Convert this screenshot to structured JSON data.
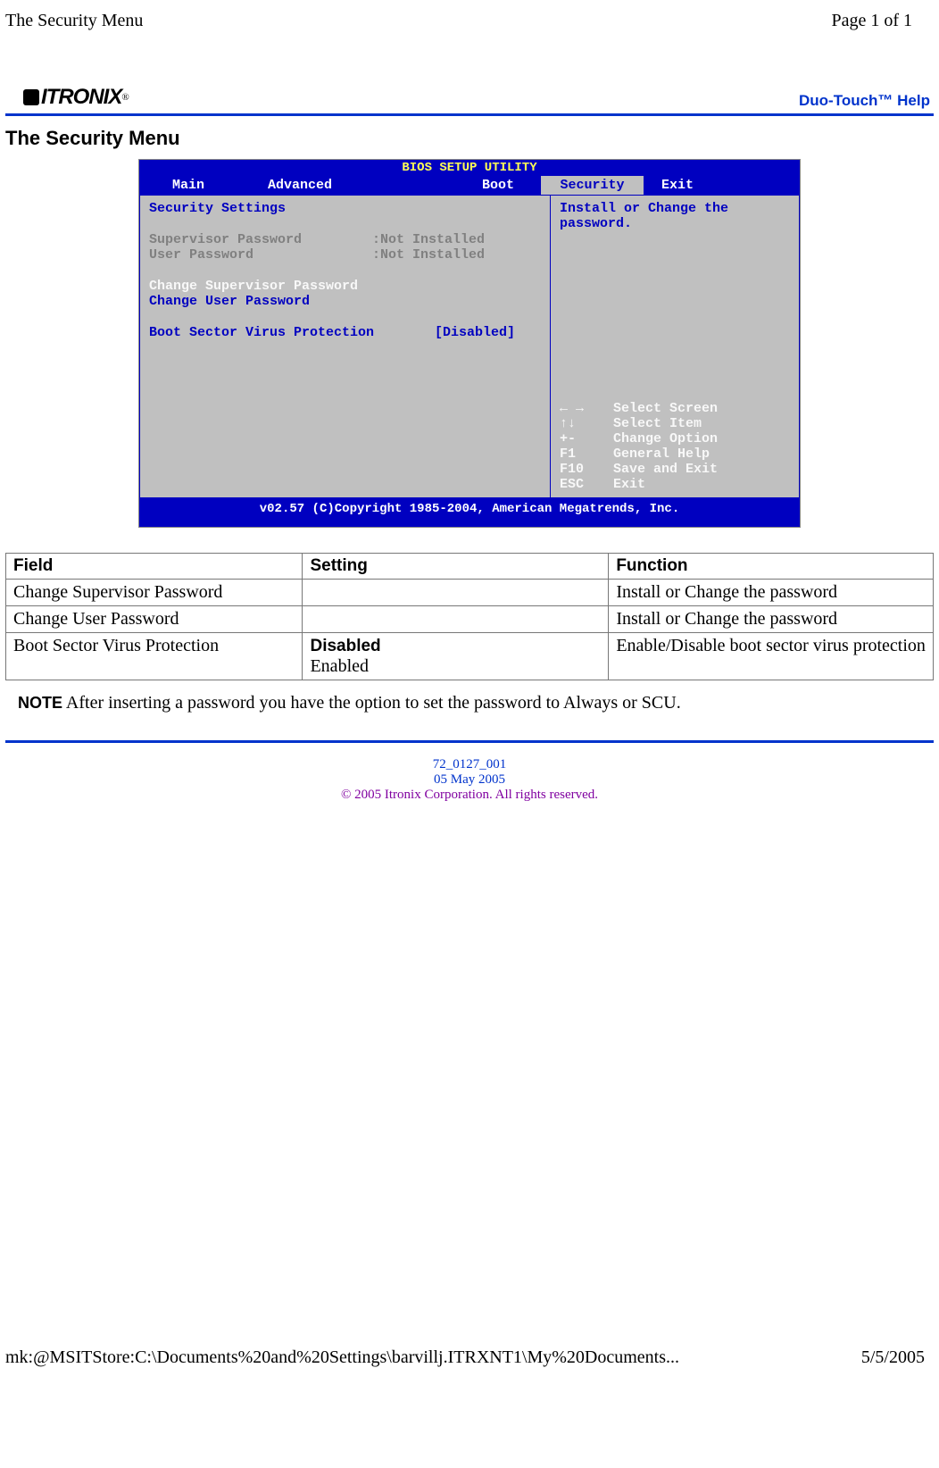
{
  "header": {
    "title": "The Security Menu",
    "page_info": "Page 1 of 1"
  },
  "brand": {
    "name": "ITRONIX",
    "reg": "®",
    "help_link": "Duo-Touch™ Help"
  },
  "heading": "The Security Menu",
  "bios": {
    "title": "BIOS SETUP UTILITY",
    "menu": {
      "main": "Main",
      "advanced": "Advanced",
      "boot": "Boot",
      "security": "Security",
      "exit": "Exit"
    },
    "left": {
      "heading": "Security Settings",
      "supervisor_label": "Supervisor Password",
      "supervisor_value": ":Not Installed",
      "user_label": "User Password",
      "user_value": ":Not Installed",
      "change_supervisor": "Change Supervisor Password",
      "change_user": "Change User Password",
      "boot_sector_label": "Boot Sector Virus Protection",
      "boot_sector_value": "[Disabled]"
    },
    "right": {
      "help_line1": "Install or Change the",
      "help_line2": "password.",
      "nav": [
        {
          "key": "← →",
          "action": "Select Screen"
        },
        {
          "key": "↑↓",
          "action": "Select Item"
        },
        {
          "key": "+-",
          "action": "Change Option"
        },
        {
          "key": "F1",
          "action": "General Help"
        },
        {
          "key": "F10",
          "action": "Save and Exit"
        },
        {
          "key": "ESC",
          "action": "Exit"
        }
      ]
    },
    "footer": "v02.57 (C)Copyright 1985-2004, American Megatrends, Inc."
  },
  "table": {
    "headers": [
      "Field",
      "Setting",
      "Function"
    ],
    "rows": [
      {
        "field": "Change Supervisor Password",
        "setting_bold": "",
        "setting_plain": "",
        "function": "Install or Change the password"
      },
      {
        "field": "Change User Password",
        "setting_bold": "",
        "setting_plain": "",
        "function": "Install or Change the password"
      },
      {
        "field": "Boot Sector Virus Protection",
        "setting_bold": "Disabled",
        "setting_plain": "Enabled",
        "function": "Enable/Disable boot sector virus protection"
      }
    ]
  },
  "note": {
    "label": "NOTE",
    "text": " After inserting a password you have the option to set the password to Always or SCU."
  },
  "footer_meta": {
    "doc_id": "72_0127_001",
    "date": "05 May 2005",
    "copyright": "© 2005 Itronix Corporation.  All rights reserved."
  },
  "page_footer": {
    "path": "mk:@MSITStore:C:\\Documents%20and%20Settings\\barvillj.ITRXNT1\\My%20Documents...",
    "date": "5/5/2005"
  }
}
